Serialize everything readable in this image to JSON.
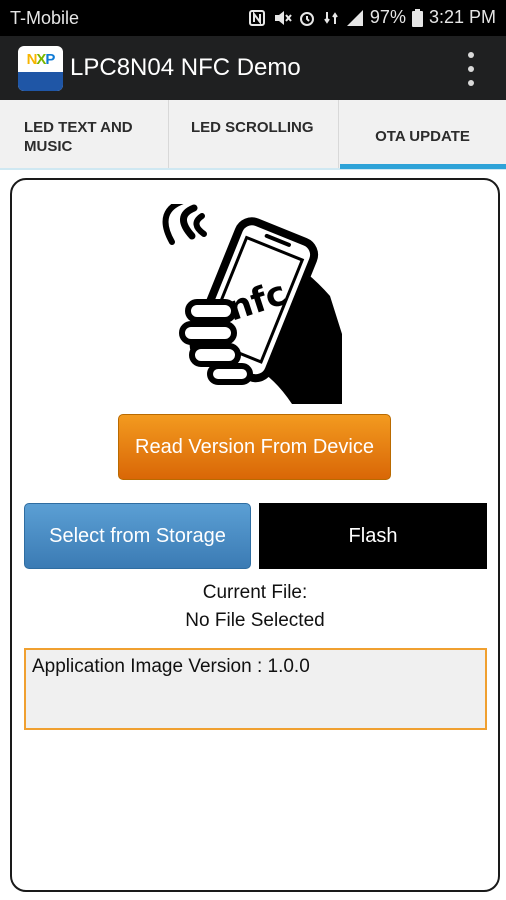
{
  "status_bar": {
    "carrier": "T-Mobile",
    "battery": "97%",
    "time": "3:21 PM",
    "icons": [
      "nfc-icon",
      "mute-icon",
      "alarm-icon",
      "data-icon",
      "signal-icon",
      "battery-icon"
    ]
  },
  "app_bar": {
    "title": "LPC8N04 NFC Demo",
    "logo_icon": "nxp-logo-icon",
    "menu_icon": "overflow-menu-icon"
  },
  "tabs": [
    {
      "label": "LED TEXT AND MUSIC",
      "selected": false
    },
    {
      "label": "LED SCROLLING",
      "selected": false
    },
    {
      "label": "OTA UPDATE",
      "selected": true
    }
  ],
  "colors": {
    "accent": "#2ea3d8",
    "read_button": "#e47d12",
    "select_button": "#4a8cc4",
    "flash_button": "#000000",
    "version_border": "#f0a030"
  },
  "main": {
    "illustration_icon": "nfc-phone-hand-icon",
    "illustration_text": "nfc",
    "read_button": "Read Version From Device",
    "select_button": "Select from Storage",
    "flash_button": "Flash",
    "current_file_label": "Current File:",
    "current_file_value": "No File Selected",
    "version_text": "Application Image Version : 1.0.0"
  }
}
